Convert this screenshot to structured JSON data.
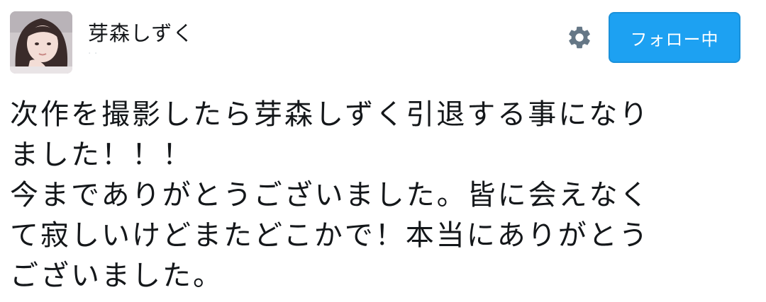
{
  "user": {
    "display_name": "芽森しずく",
    "screen_name": "· ·"
  },
  "actions": {
    "settings_icon": "gear-icon",
    "follow_label": "フォロー中",
    "follow_color": "#1da1f2"
  },
  "tweet": {
    "lines": [
      "次作を撮影したら芽森しずく引退する事になり",
      "ました！！！",
      "今までありがとうございました。皆に会えなく",
      "て寂しいけどまたどこかで！本当にありがとう",
      "ございました。"
    ]
  }
}
